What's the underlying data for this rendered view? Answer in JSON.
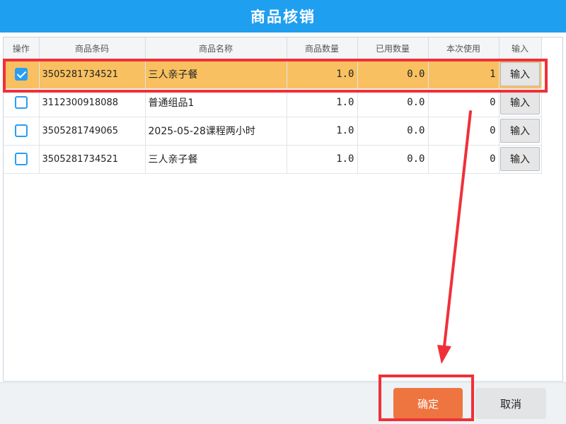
{
  "dialog": {
    "title": "商品核销"
  },
  "table": {
    "columns": [
      "操作",
      "商品条码",
      "商品名称",
      "商品数量",
      "已用数量",
      "本次使用",
      "输入"
    ],
    "rows": [
      {
        "checked": true,
        "barcode": "3505281734521",
        "name": "三人亲子餐",
        "qty": "1.0",
        "used": "0.0",
        "use_now": "1",
        "action": "输入"
      },
      {
        "checked": false,
        "barcode": "3112300918088",
        "name": "普通组品1",
        "qty": "1.0",
        "used": "0.0",
        "use_now": "0",
        "action": "输入"
      },
      {
        "checked": false,
        "barcode": "3505281749065",
        "name": "2025-05-28课程两小时",
        "qty": "1.0",
        "used": "0.0",
        "use_now": "0",
        "action": "输入"
      },
      {
        "checked": false,
        "barcode": "3505281734521",
        "name": "三人亲子餐",
        "qty": "1.0",
        "used": "0.0",
        "use_now": "0",
        "action": "输入"
      }
    ]
  },
  "footer": {
    "confirm_label": "确定",
    "cancel_label": "取消"
  },
  "colors": {
    "title_bar": "#1f9ff0",
    "selected_row": "#f8c060",
    "confirm": "#ee7540",
    "highlight": "#f03038"
  }
}
